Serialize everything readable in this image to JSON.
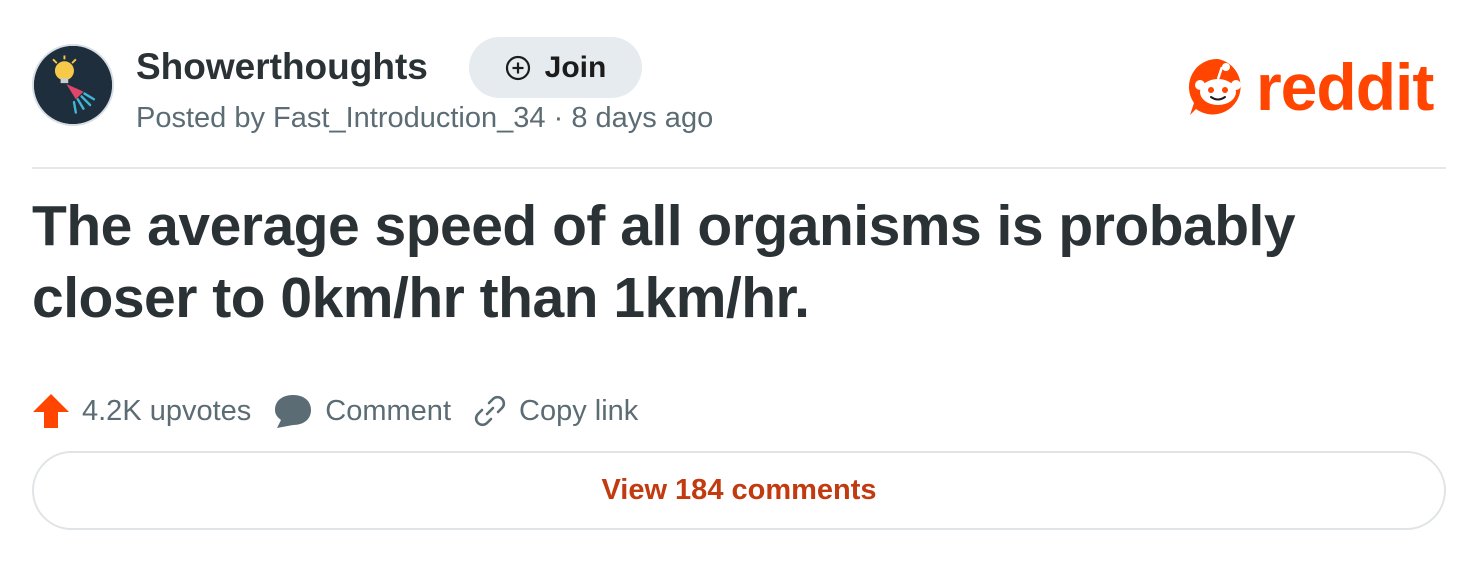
{
  "subreddit": {
    "name": "Showerthoughts",
    "avatar_icon": "lightbulb-shower-icon",
    "join_label": "Join",
    "join_icon": "plus-circle-icon"
  },
  "meta": {
    "posted_by_prefix": "Posted by",
    "author": "Fast_Introduction_34",
    "separator": "·",
    "time_ago": "8 days ago"
  },
  "brand": {
    "wordmark": "reddit",
    "logo_icon": "reddit-snoo-icon",
    "color": "#ff4500"
  },
  "post": {
    "title": "The average speed of all organisms is probably closer to 0km/hr than 1km/hr."
  },
  "actions": {
    "upvotes": "4.2K upvotes",
    "upvote_icon": "upvote-arrow-icon",
    "upvote_color": "#ff4500",
    "comment": "Comment",
    "comment_icon": "comment-bubble-icon",
    "copy_link": "Copy link",
    "copy_link_icon": "link-icon"
  },
  "footer": {
    "view_comments": "View 184 comments",
    "accent": "#c13a10"
  }
}
